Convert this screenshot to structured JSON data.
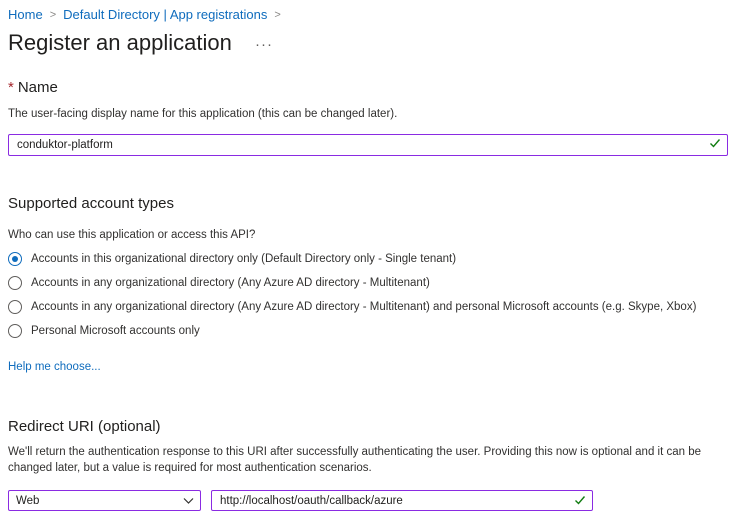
{
  "breadcrumb": {
    "items": [
      "Home",
      "Default Directory | App registrations"
    ]
  },
  "page": {
    "title": "Register an application",
    "more_label": "···"
  },
  "name_section": {
    "required_mark": "*",
    "heading": "Name",
    "description": "The user-facing display name for this application (this can be changed later).",
    "value": "conduktor-platform"
  },
  "account_types": {
    "heading": "Supported account types",
    "question": "Who can use this application or access this API?",
    "options": [
      {
        "label": "Accounts in this organizational directory only (Default Directory only - Single tenant)",
        "selected": true
      },
      {
        "label": "Accounts in any organizational directory (Any Azure AD directory - Multitenant)",
        "selected": false
      },
      {
        "label": "Accounts in any organizational directory (Any Azure AD directory - Multitenant) and personal Microsoft accounts (e.g. Skype, Xbox)",
        "selected": false
      },
      {
        "label": "Personal Microsoft accounts only",
        "selected": false
      }
    ],
    "help_link": "Help me choose..."
  },
  "redirect": {
    "heading": "Redirect URI (optional)",
    "description_line1": "We'll return the authentication response to this URI after successfully authenticating the user. Providing this now is optional and it can be",
    "description_line2": "changed later, but a value is required for most authentication scenarios.",
    "platform": "Web",
    "uri": "http://localhost/oauth/callback/azure"
  },
  "colors": {
    "link": "#0f6cbd",
    "input_border": "#8a2be2",
    "valid_check": "#107c10",
    "required": "#a4262c"
  }
}
